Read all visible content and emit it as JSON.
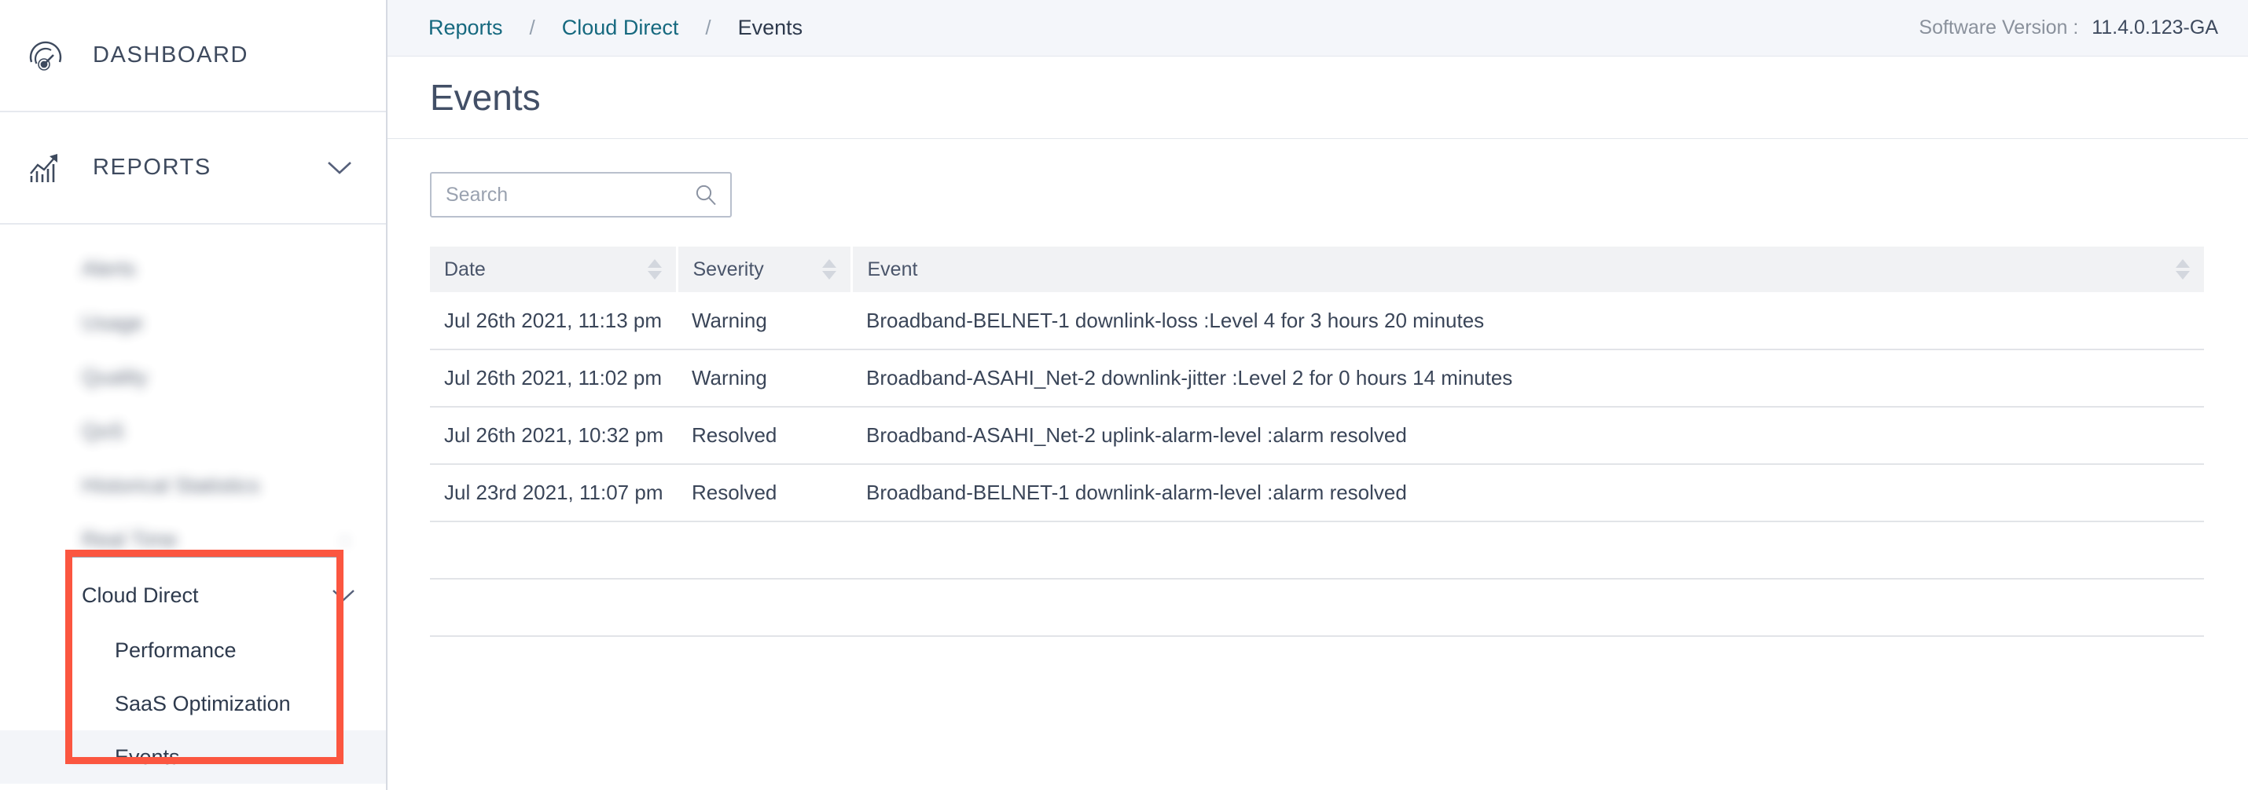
{
  "sidebar": {
    "sections": [
      {
        "label": "DASHBOARD",
        "icon": "gauge-icon",
        "chevron": false
      },
      {
        "label": "REPORTS",
        "icon": "trend-chart-icon",
        "chevron": true
      }
    ],
    "nav_items": [
      {
        "label": "Alerts",
        "blurred": true,
        "arrow": ""
      },
      {
        "label": "Usage",
        "blurred": true,
        "arrow": ""
      },
      {
        "label": "Quality",
        "blurred": true,
        "arrow": ""
      },
      {
        "label": "QoS",
        "blurred": true,
        "arrow": ""
      },
      {
        "label": "Historical Statistics",
        "blurred": true,
        "arrow": ""
      },
      {
        "label": "Real Time",
        "blurred": true,
        "arrow": "›"
      }
    ],
    "group": {
      "label": "Cloud Direct",
      "chevron": "chevron-down-icon",
      "items": [
        {
          "label": "Performance",
          "active": false
        },
        {
          "label": "SaaS Optimization",
          "active": false
        },
        {
          "label": "Events",
          "active": true
        }
      ]
    },
    "highlight_color": "#fb5640"
  },
  "topbar": {
    "breadcrumbs": [
      {
        "label": "Reports",
        "current": false
      },
      {
        "label": "Cloud Direct",
        "current": false
      },
      {
        "label": "Events",
        "current": true
      }
    ],
    "separator": "/",
    "version_label": "Software Version :",
    "version_value": "11.4.0.123-GA",
    "link_color": "#16697f"
  },
  "page": {
    "title": "Events"
  },
  "search": {
    "value": "",
    "placeholder": "Search",
    "icon": "search-icon"
  },
  "table": {
    "columns": [
      {
        "label": "Date",
        "sortable": true
      },
      {
        "label": "Severity",
        "sortable": true
      },
      {
        "label": "Event",
        "sortable": true
      }
    ],
    "rows": [
      {
        "date": "Jul 26th 2021, 11:13 pm",
        "severity": "Warning",
        "severity_kind": "warning",
        "event": "Broadband-BELNET-1 downlink-loss :Level 4 for 3 hours 20 minutes"
      },
      {
        "date": "Jul 26th 2021, 11:02 pm",
        "severity": "Warning",
        "severity_kind": "warning",
        "event": "Broadband-ASAHI_Net-2 downlink-jitter :Level 2 for 0 hours 14 minutes"
      },
      {
        "date": "Jul 26th 2021, 10:32 pm",
        "severity": "Resolved",
        "severity_kind": "resolved",
        "event": "Broadband-ASAHI_Net-2 uplink-alarm-level :alarm resolved"
      },
      {
        "date": "Jul 23rd 2021, 11:07 pm",
        "severity": "Resolved",
        "severity_kind": "resolved",
        "event": "Broadband-BELNET-1 downlink-alarm-level :alarm resolved"
      }
    ],
    "empty_rows": 2,
    "colors": {
      "warning": "#f0a113",
      "resolved": "#11921b",
      "header_bg": "#f1f2f4"
    }
  }
}
